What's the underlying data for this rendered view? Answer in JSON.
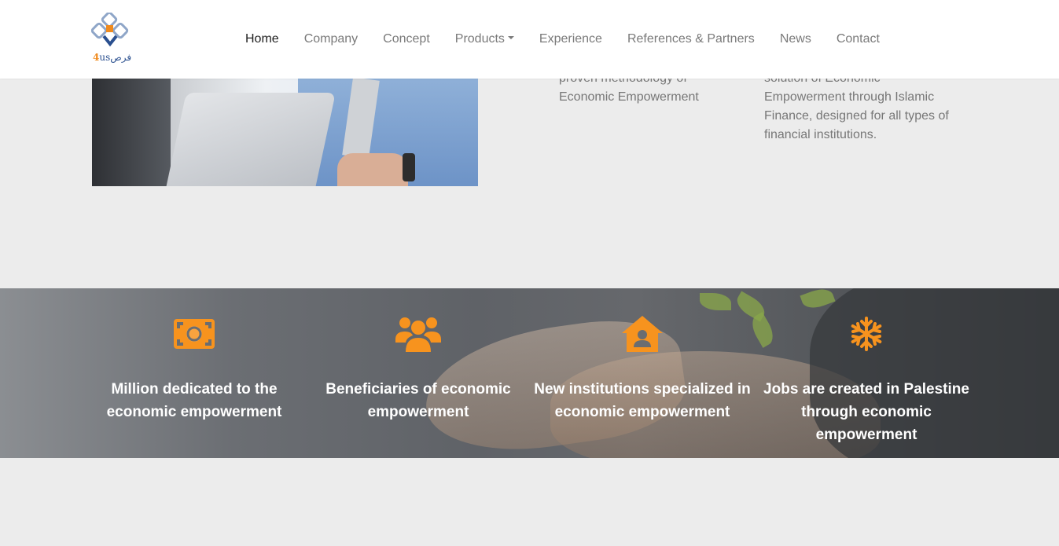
{
  "header": {
    "logo": {
      "icon": "logo-mark-icon",
      "text_prefix": "4",
      "text_us": "us",
      "text_arabic": "فرص"
    },
    "nav": [
      {
        "label": "Home",
        "active": true
      },
      {
        "label": "Company"
      },
      {
        "label": "Concept"
      },
      {
        "label": "Products",
        "dropdown": true
      },
      {
        "label": "Experience"
      },
      {
        "label": "References & Partners"
      },
      {
        "label": "News"
      },
      {
        "label": "Contact"
      }
    ]
  },
  "content": {
    "col_a": [
      "proven methodology of",
      "Economic Empowerment"
    ],
    "col_b": [
      "solution of Economic",
      "Empowerment through Islamic",
      "Finance, designed for all types of",
      "financial institutions."
    ]
  },
  "stats": {
    "accent": "#f7931e",
    "items": [
      {
        "icon": "money-bill-icon",
        "label": "Million dedicated to the economic empowerment"
      },
      {
        "icon": "users-icon",
        "label": "Beneficiaries of economic empowerment"
      },
      {
        "icon": "house-user-icon",
        "label": "New institutions specialized in economic empowerment"
      },
      {
        "icon": "snowflake-icon",
        "label": "Jobs are created in Palestine through economic empowerment"
      }
    ]
  }
}
